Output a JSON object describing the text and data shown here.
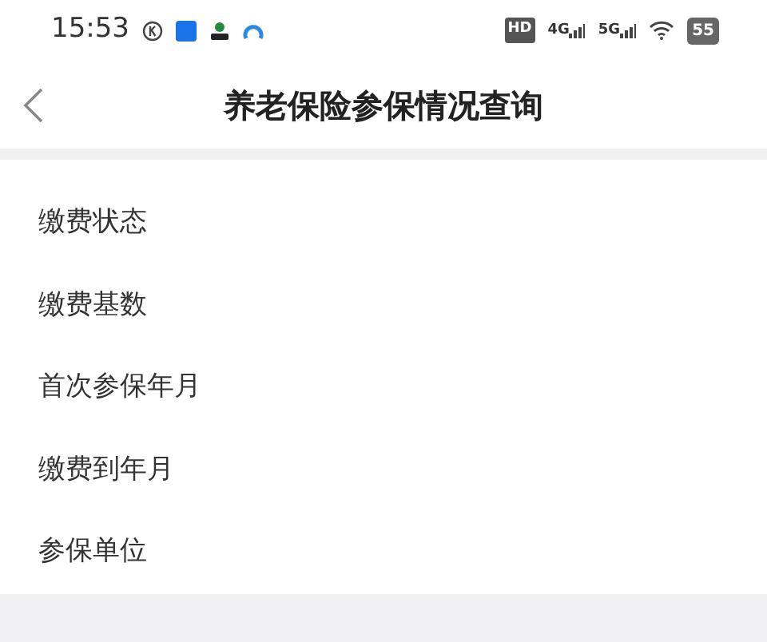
{
  "status_bar": {
    "time": "15:53",
    "hd": "HD",
    "networks": [
      "4G",
      "5G"
    ],
    "battery": "55"
  },
  "header": {
    "title": "养老保险参保情况查询"
  },
  "items": [
    {
      "label": "缴费状态"
    },
    {
      "label": "缴费基数"
    },
    {
      "label": "首次参保年月"
    },
    {
      "label": "缴费到年月"
    },
    {
      "label": "参保单位"
    }
  ]
}
